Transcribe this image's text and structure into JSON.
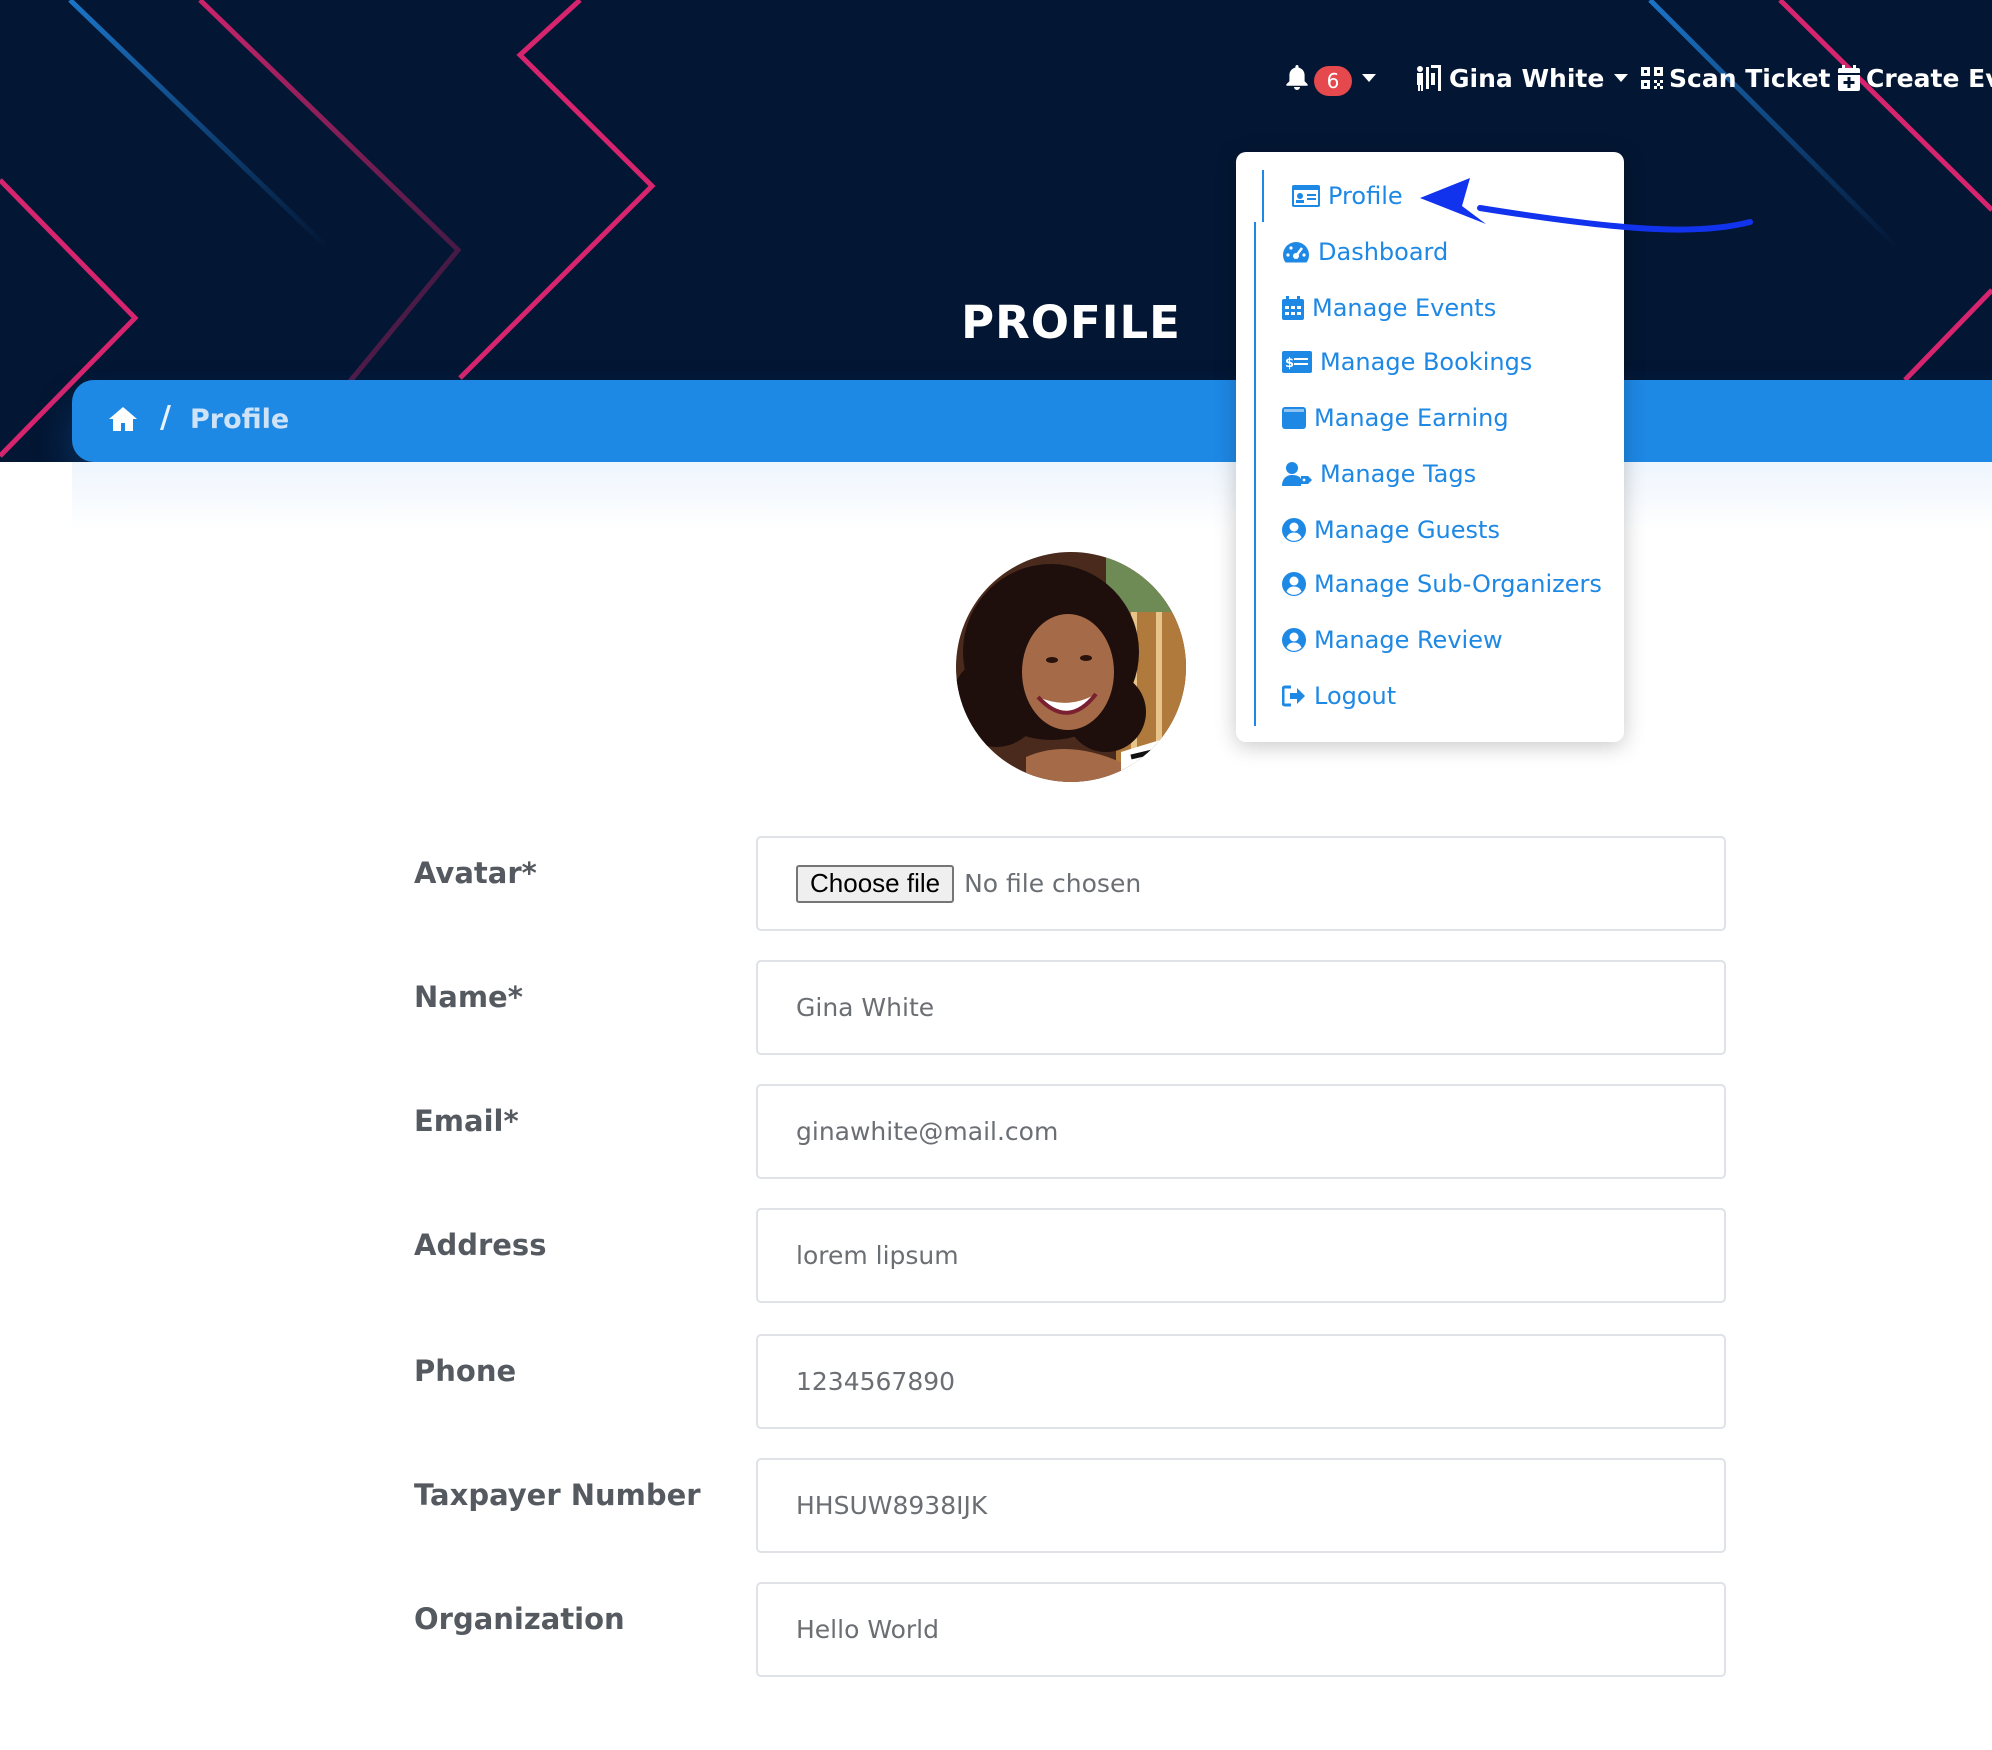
{
  "header": {
    "notification_count": "6",
    "user_name": "Gina White",
    "scan_ticket_label": "Scan Ticket",
    "create_event_label": "Create Eve",
    "page_title": "PROFILE"
  },
  "breadcrumb": {
    "current": "Profile",
    "separator": "/"
  },
  "dropdown": {
    "items": [
      {
        "label": "Profile",
        "icon": "id-card-icon"
      },
      {
        "label": "Dashboard",
        "icon": "gauge-icon"
      },
      {
        "label": "Manage Events",
        "icon": "calendar-icon"
      },
      {
        "label": "Manage Bookings",
        "icon": "money-check-icon"
      },
      {
        "label": "Manage Earning",
        "icon": "wallet-icon"
      },
      {
        "label": "Manage Tags",
        "icon": "user-tag-icon"
      },
      {
        "label": "Manage Guests",
        "icon": "user-circle-icon"
      },
      {
        "label": "Manage Sub-Organizers",
        "icon": "user-circle-icon"
      },
      {
        "label": "Manage Review",
        "icon": "user-circle-icon"
      },
      {
        "label": "Logout",
        "icon": "sign-out-icon"
      }
    ]
  },
  "form": {
    "avatar": {
      "label": "Avatar*",
      "button": "Choose file",
      "status": "No file chosen"
    },
    "name": {
      "label": "Name*",
      "value": "Gina White"
    },
    "email": {
      "label": "Email*",
      "value": "ginawhite@mail.com"
    },
    "address": {
      "label": "Address",
      "value": "lorem lipsum"
    },
    "phone": {
      "label": "Phone",
      "value": "1234567890"
    },
    "taxpayer": {
      "label": "Taxpayer Number",
      "value": "HHSUW8938IJK"
    },
    "organization": {
      "label": "Organization",
      "value": "Hello World"
    }
  },
  "colors": {
    "hero_bg": "#031633",
    "accent": "#1e88e5",
    "badge": "#e5484d",
    "annotation_arrow": "#1133ee"
  }
}
